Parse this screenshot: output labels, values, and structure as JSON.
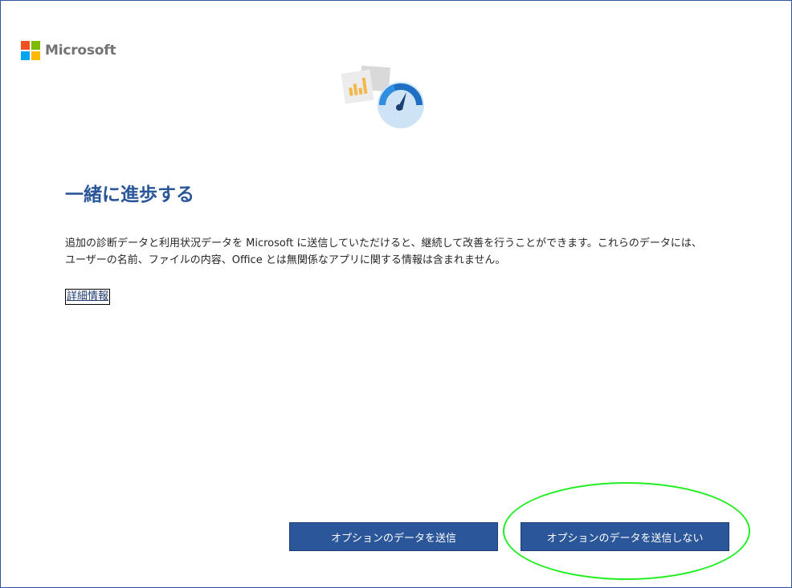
{
  "brand": {
    "name": "Microsoft",
    "logo_colors": [
      "#f25022",
      "#7fba00",
      "#00a4ef",
      "#ffb900"
    ]
  },
  "dialog": {
    "title": "一緒に進歩する",
    "description": "追加の診断データと利用状況データを Microsoft に送信していただけると、継続して改善を行うことができます。これらのデータには、ユーザーの名前、ファイルの内容、Office とは無関係なアプリに関する情報は含まれません。",
    "learn_more": "詳細情報"
  },
  "buttons": {
    "send_optional": "オプションのデータを送信",
    "dont_send_optional": "オプションのデータを送信しない"
  },
  "colors": {
    "accent": "#2b579a",
    "annotation": "#22ee22"
  },
  "icons": {
    "hero": "diagnostics-gauge-icon"
  }
}
